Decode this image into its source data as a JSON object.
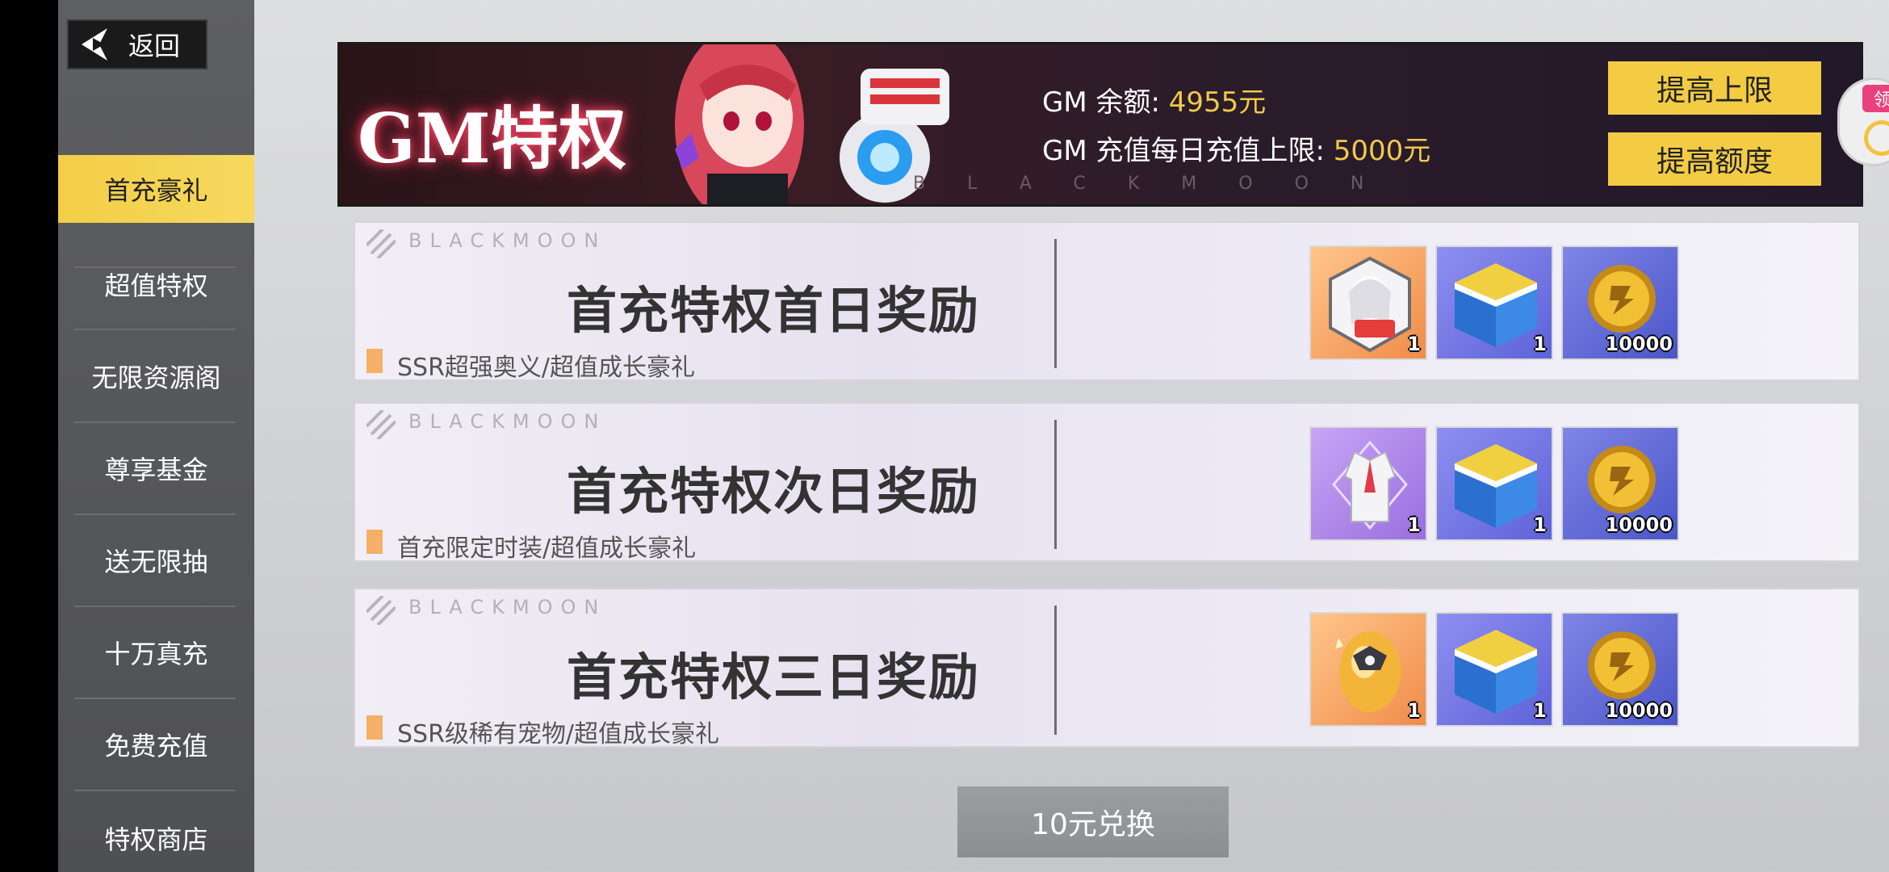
{
  "back": {
    "label": "返回"
  },
  "sidebar": {
    "items": [
      {
        "label": "首充豪礼",
        "active": true
      },
      {
        "label": "超值特权",
        "active": false
      },
      {
        "label": "无限资源阁",
        "active": false
      },
      {
        "label": "尊享基金",
        "active": false
      },
      {
        "label": "送无限抽",
        "active": false
      },
      {
        "label": "十万真充",
        "active": false
      },
      {
        "label": "免费充值",
        "active": false
      },
      {
        "label": "特权商店",
        "active": false
      }
    ]
  },
  "banner": {
    "title": "GM特权",
    "balance_label": "GM 余额: ",
    "balance_value": "4955元",
    "limit_label": "GM 充值每日充值上限: ",
    "limit_value": "5000元",
    "watermark": "BLACKMOON",
    "raise_limit_label": "提高上限",
    "raise_amount_label": "提高额度"
  },
  "side_bubble": {
    "tag": "领"
  },
  "cards": [
    {
      "watermark": "BLACKMOON",
      "title": "首充特权首日奖励",
      "subtitle": "SSR超强奥义/超值成长豪礼",
      "rewards": [
        {
          "icon": "character-skill-card-icon",
          "qty": "1"
        },
        {
          "icon": "blue-gift-box-icon",
          "qty": "1"
        },
        {
          "icon": "gold-coin-icon",
          "qty": "10000"
        }
      ]
    },
    {
      "watermark": "BLACKMOON",
      "title": "首充特权次日奖励",
      "subtitle": "首充限定时装/超值成长豪礼",
      "rewards": [
        {
          "icon": "outfit-costume-icon",
          "qty": "1"
        },
        {
          "icon": "blue-gift-box-icon",
          "qty": "1"
        },
        {
          "icon": "gold-coin-icon",
          "qty": "10000"
        }
      ]
    },
    {
      "watermark": "BLACKMOON",
      "title": "首充特权三日奖励",
      "subtitle": "SSR级稀有宠物/超值成长豪礼",
      "rewards": [
        {
          "icon": "pet-egg-icon",
          "qty": "1"
        },
        {
          "icon": "blue-gift-box-icon",
          "qty": "1"
        },
        {
          "icon": "gold-coin-icon",
          "qty": "10000"
        }
      ]
    }
  ],
  "exchange": {
    "label": "10元兑换"
  },
  "colors": {
    "accent": "#f3cc44",
    "sidebar": "#58595d",
    "card_bg": "#ece9f4",
    "sub_bar": "#f3b066"
  }
}
